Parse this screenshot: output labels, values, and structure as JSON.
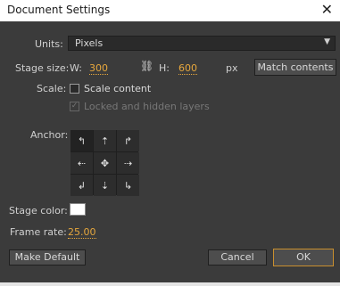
{
  "window": {
    "title": "Document Settings"
  },
  "units": {
    "label": "Units:",
    "value": "Pixels"
  },
  "stage_size": {
    "label": "Stage size:",
    "w_label": "W:",
    "w_value": "300",
    "h_label": "H:",
    "h_value": "600",
    "unit": "px",
    "match_button": "Match contents"
  },
  "scale": {
    "label": "Scale:",
    "scale_content": "Scale content",
    "locked_hidden": "Locked and hidden layers"
  },
  "anchor": {
    "label": "Anchor:",
    "cells": [
      "↰",
      "⇡",
      "↱",
      "⇠",
      "✥",
      "⇢",
      "↲",
      "⇣",
      "↳"
    ]
  },
  "stage_color": {
    "label": "Stage color:",
    "color": "#ffffff"
  },
  "frame_rate": {
    "label": "Frame rate:",
    "value": "25.00"
  },
  "buttons": {
    "make_default": "Make Default",
    "cancel": "Cancel",
    "ok": "OK"
  },
  "colors": {
    "accent": "#e6a73d",
    "dialog_bg": "#3b3b3b"
  }
}
